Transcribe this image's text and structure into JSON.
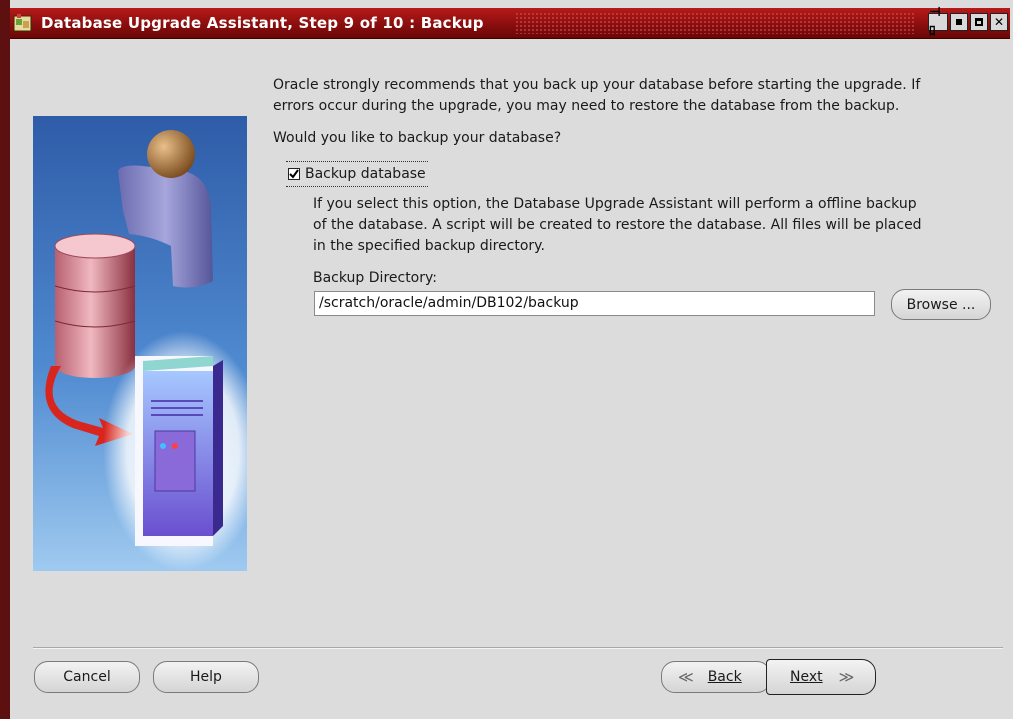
{
  "window": {
    "title": "Database Upgrade Assistant, Step 9 of 10 : Backup",
    "controls": {
      "pin": "pin-icon",
      "minimize": "minimize-icon",
      "maximize": "maximize-icon",
      "close": "close-icon"
    },
    "colors": {
      "titlebar": "#8a0e0e",
      "background": "#dcdcdc"
    }
  },
  "intro": {
    "line1": "Oracle strongly recommends that you back up your database before starting the upgrade. If",
    "line2": "errors occur during the upgrade, you may need to restore the database from the backup."
  },
  "question": "Would you like to backup your database?",
  "backup_checkbox": {
    "label": "Backup database",
    "checked": true
  },
  "backup_description": {
    "line1": "If you select this option, the Database Upgrade Assistant will perform a offline backup",
    "line2": "of the database. A script will be created to restore the database. All files will be placed",
    "line3": "in the specified backup directory."
  },
  "backup_directory": {
    "label": "Backup Directory:",
    "value": "/scratch/oracle/admin/DB102/backup",
    "browse_label": "Browse ..."
  },
  "footer": {
    "cancel": "Cancel",
    "help": "Help",
    "back": "Back",
    "next": "Next"
  }
}
